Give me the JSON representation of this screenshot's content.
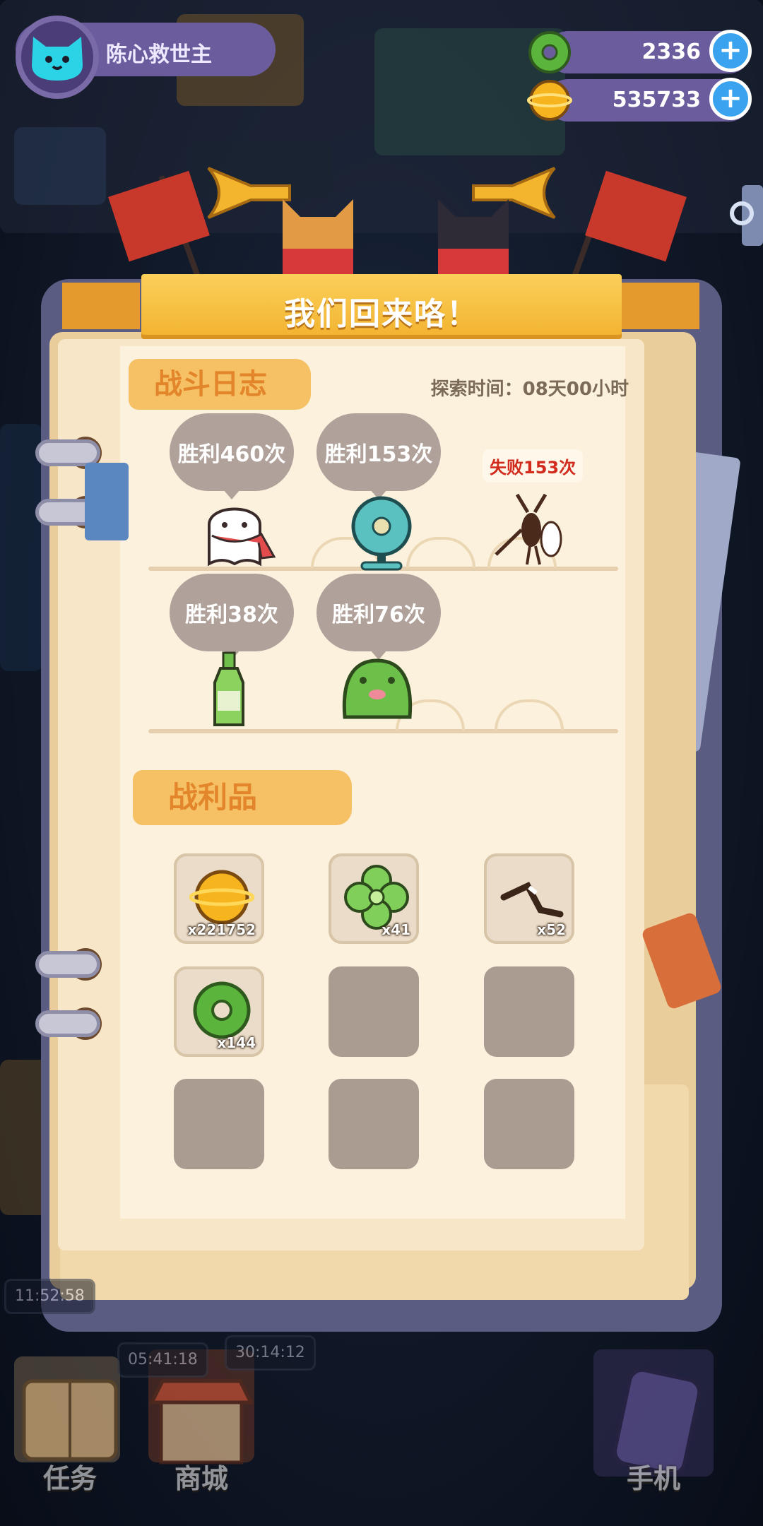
{
  "hud": {
    "player_name": "陈心救世主",
    "donut_currency": "2336",
    "gold_currency": "535733",
    "plus_label": "+"
  },
  "modal": {
    "title": "我们回来咯！",
    "battle_log": {
      "heading": "战斗日志",
      "explore_time": "探索时间：08天00小时",
      "entries": [
        {
          "result": "胜利460次",
          "enemy": "ghost-with-scarf-icon"
        },
        {
          "result": "胜利153次",
          "enemy": "electric-fan-icon"
        },
        {
          "result": "失败153次",
          "enemy": "mosquito-icon"
        },
        {
          "result": "胜利38次",
          "enemy": "bottle-icon"
        },
        {
          "result": "胜利76次",
          "enemy": "frog-icon"
        }
      ]
    },
    "loot": {
      "heading": "战利品",
      "items": [
        {
          "icon": "gold-coin-icon",
          "count": "x221752"
        },
        {
          "icon": "clover-icon",
          "count": "x41"
        },
        {
          "icon": "mosquito-leg-icon",
          "count": "x52"
        },
        {
          "icon": "green-donut-icon",
          "count": "x144"
        }
      ]
    }
  },
  "bottom_nav": {
    "timers": [
      "11:52:58",
      "05:41:18",
      "30:14:12"
    ],
    "tasks": "任务",
    "shop": "商城",
    "phone": "手机"
  },
  "colors": {
    "banner": "#f2b22f",
    "section_tag": "#f6c164",
    "defeat_text": "#d22b1e",
    "plus_button": "#3aa3f0"
  }
}
